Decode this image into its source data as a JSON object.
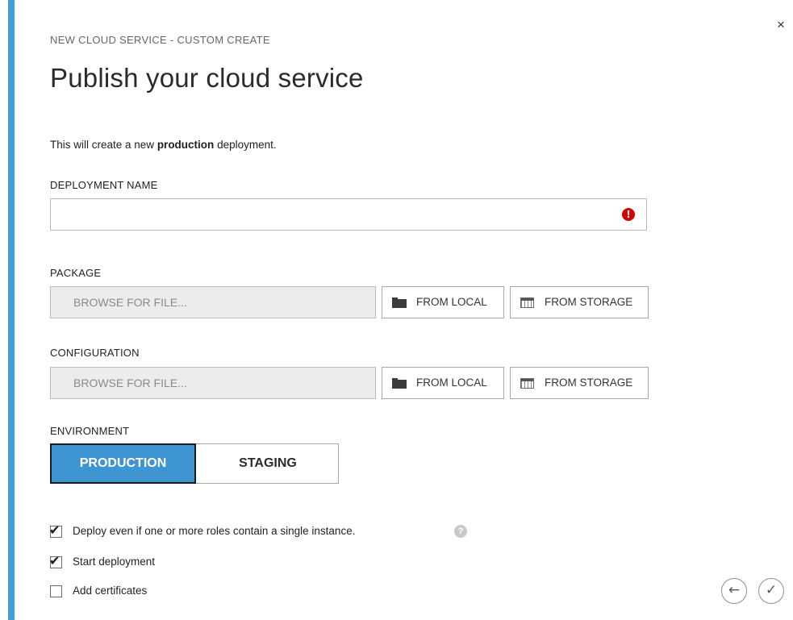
{
  "dialog": {
    "subtitle": "NEW CLOUD SERVICE - CUSTOM CREATE",
    "title": "Publish your cloud service",
    "intro_prefix": "This will create a new ",
    "intro_bold": "production",
    "intro_suffix": " deployment.",
    "close_glyph": "×",
    "accent_color": "#3fa0dc"
  },
  "deployment_name": {
    "label": "DEPLOYMENT NAME",
    "value": "",
    "error_icon": "!"
  },
  "package": {
    "label": "PACKAGE",
    "file_placeholder": "BROWSE FOR FILE...",
    "from_local_label": "FROM LOCAL",
    "from_storage_label": "FROM STORAGE"
  },
  "configuration": {
    "label": "CONFIGURATION",
    "file_placeholder": "BROWSE FOR FILE...",
    "from_local_label": "FROM LOCAL",
    "from_storage_label": "FROM STORAGE"
  },
  "environment": {
    "label": "ENVIRONMENT",
    "options": [
      "PRODUCTION",
      "STAGING"
    ],
    "selected": "PRODUCTION",
    "selected_color": "#3f95d2"
  },
  "options": [
    {
      "label": "Deploy even if one or more roles contain a single instance.",
      "checked": true,
      "help": "?"
    },
    {
      "label": "Start deployment",
      "checked": true
    },
    {
      "label": "Add certificates",
      "checked": false
    }
  ],
  "nav": {
    "back_glyph": "←",
    "confirm_glyph": "✓"
  }
}
